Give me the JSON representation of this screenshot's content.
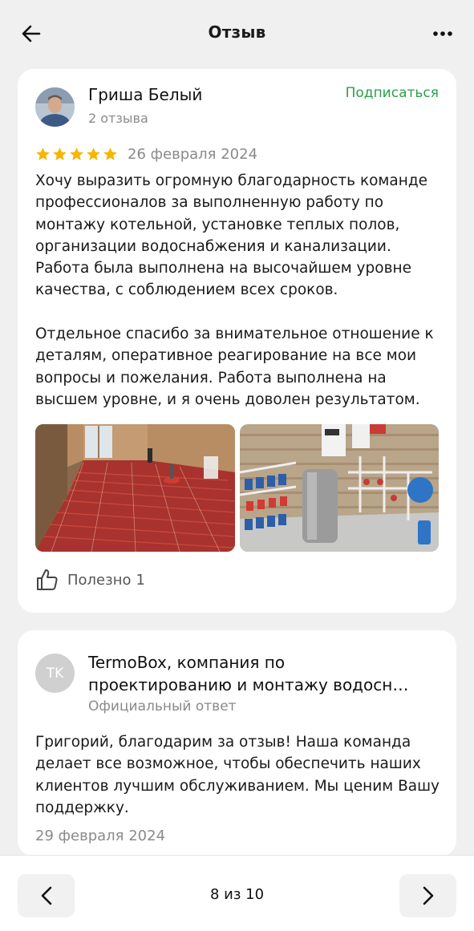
{
  "header": {
    "title": "Отзыв",
    "back_icon": "arrow-left-icon",
    "more_icon": "more-horizontal-icon"
  },
  "review": {
    "author": "Гриша Белый",
    "author_meta": "2 отзыва",
    "subscribe_label": "Подписаться",
    "rating": 5,
    "rating_max": 5,
    "date": "26 февраля 2024",
    "text": "Хочу выразить огромную благодарность команде профессионалов за выполненную работу по монтажу котельной, установке теплых полов, организации водоснабжения и канализации. Работа была выполнена на высочайшем уровне качества, с соблюдением всех сроков.\n\nОтдельное спасибо за внимательное отношение к деталям, оперативное реагирование на все мои вопросы и пожелания. Работа выполнена на высшем уровне, и я очень доволен результатом.",
    "photo_count": 2,
    "useful_label": "Полезно",
    "useful_count": "1"
  },
  "reply": {
    "initials": "TK",
    "author": "TermoBox, компания по проектированию и монтажу водосн…",
    "meta": "Официальный ответ",
    "text": "Григорий, благодарим за отзыв! Наша команда делает все возможное, чтобы обеспечить наших клиентов лучшим обслуживанием. Мы ценим Вашу поддержку.",
    "date": "29 февраля 2024"
  },
  "pagination": {
    "label": "8 из 10",
    "prev_icon": "chevron-left-icon",
    "next_icon": "chevron-right-icon"
  },
  "colors": {
    "accent_green": "#2aa04a",
    "star": "#f7b500",
    "background": "#f0f0f0"
  }
}
